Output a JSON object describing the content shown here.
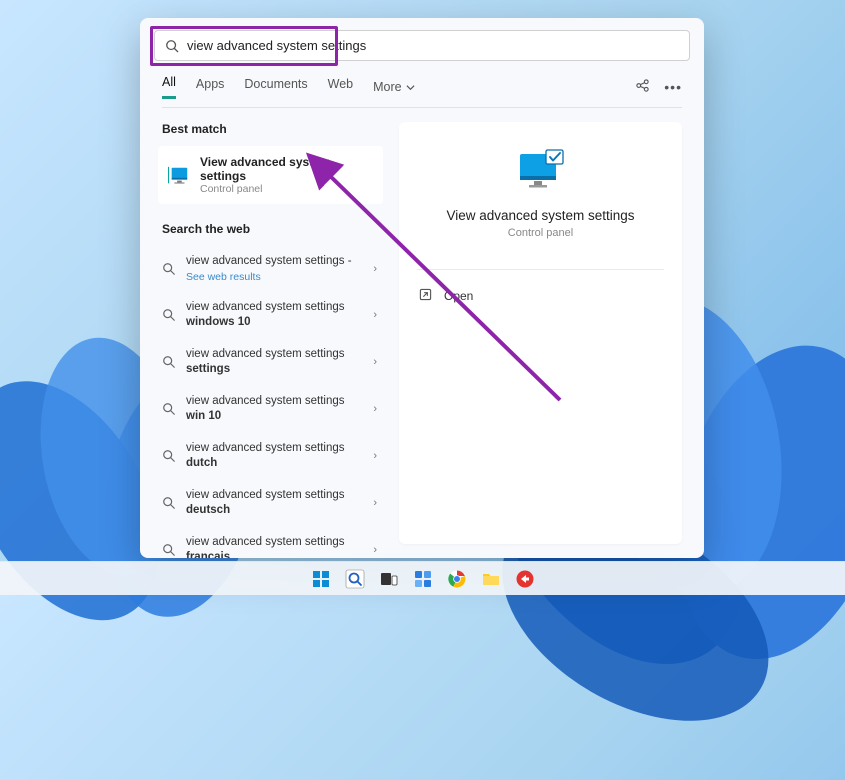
{
  "search": {
    "value": "view advanced system settings"
  },
  "tabs": {
    "items": [
      "All",
      "Apps",
      "Documents",
      "Web"
    ],
    "more": "More",
    "active": 0
  },
  "bestMatch": {
    "label": "Best match",
    "title": "View advanced system settings",
    "subtitle": "Control panel"
  },
  "searchWeb": {
    "label": "Search the web",
    "firstSub": "See web results",
    "items": [
      {
        "prefix": "view advanced system settings",
        "suffix": " - "
      },
      {
        "prefix": "view advanced system settings ",
        "bold": "windows 10"
      },
      {
        "prefix": "view advanced system settings ",
        "bold": "settings"
      },
      {
        "prefix": "view advanced system settings ",
        "bold": "win 10"
      },
      {
        "prefix": "view advanced system settings ",
        "bold": "dutch"
      },
      {
        "prefix": "view advanced system settings ",
        "bold": "deutsch"
      },
      {
        "prefix": "view advanced system settings ",
        "bold": "français"
      }
    ]
  },
  "preview": {
    "title": "View advanced system settings",
    "subtitle": "Control panel",
    "open": "Open"
  }
}
